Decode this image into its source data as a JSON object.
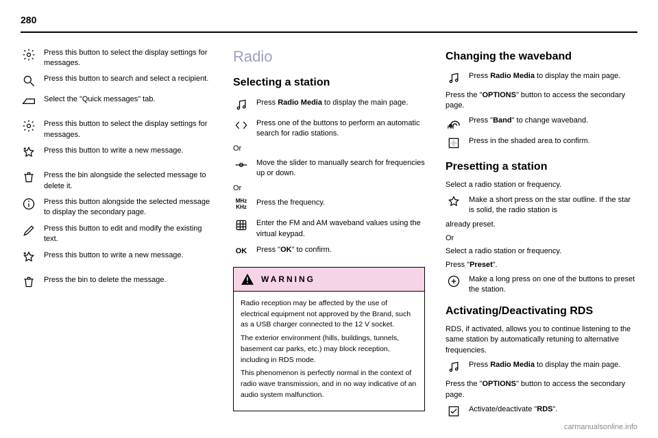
{
  "page_number": "280",
  "col1": {
    "items": [
      {
        "icon": "gear",
        "text": "Press this button to select the display settings for messages."
      },
      {
        "icon": "magnify",
        "text": "Press this button to search and select a recipient."
      },
      {
        "icon": "tab",
        "text": "Select the \"Quick messages\" tab."
      },
      {
        "icon": "gear",
        "text": "Press this button to select the display settings for messages.",
        "gap": true
      },
      {
        "icon": "star-plus",
        "text": "Press this button to write a new message."
      },
      {
        "icon": "trash",
        "text": "Press the bin alongside the selected message to delete it.",
        "gap": true
      },
      {
        "icon": "info",
        "text": "Press this button alongside the selected message to display the secondary page."
      },
      {
        "icon": "pencil",
        "text": "Press this button to edit and modify the existing text."
      },
      {
        "icon": "star-plus",
        "text": "Press this button to write a new message."
      },
      {
        "icon": "trash",
        "text": "Press the bin to delete the message.",
        "gap": true
      }
    ]
  },
  "col2": {
    "section_title": "Radio",
    "sub1": "Selecting a station",
    "items1": [
      {
        "icon": "music",
        "text_pre": "Press ",
        "text_bold": "Radio Media",
        "text_post": " to display the main page."
      },
      {
        "icon": "arrows",
        "text": "Press one of the buttons to perform an automatic search for radio stations."
      }
    ],
    "or1": "Or",
    "items2": [
      {
        "icon": "slider",
        "text": "Move the slider to manually search for frequencies up or down."
      }
    ],
    "or2": "Or",
    "items3": [
      {
        "icon": "mhz",
        "text": "Press the frequency."
      },
      {
        "icon": "keypad",
        "text": "Enter the FM and AM waveband values using the virtual keypad."
      },
      {
        "icon": "ok",
        "text_pre": "Press \"",
        "text_bold": "OK",
        "text_post": "\" to confirm."
      }
    ],
    "warning_title": "WARNING",
    "warning_body": "Radio reception may be affected by the use of electrical equipment not approved by the Brand, such as a USB charger connected to the 12 V socket.\nThe exterior environment (hills, buildings, tunnels, basement car parks, etc.) may block reception, including in RDS mode.\nThis phenomenon is perfectly normal in the context of radio wave transmission, and in no way indicative of an audio system malfunction."
  },
  "col3": {
    "sub1": "Changing the waveband",
    "items1": [
      {
        "icon": "music",
        "text_pre": "Press ",
        "text_bold": "Radio Media",
        "text_post": " to display the main page."
      }
    ],
    "para1_pre": "Press the \"",
    "para1_bold": "OPTIONS",
    "para1_post": "\" button to access the secondary page.",
    "items2": [
      {
        "icon": "fm",
        "text_pre": "Press \"",
        "text_bold": "Band",
        "text_post": "\" to change waveband."
      },
      {
        "icon": "grid",
        "text": "Press in the shaded area to confirm."
      }
    ],
    "sub2": "Presetting a station",
    "para2": "Select a radio station or frequency.",
    "items3": [
      {
        "icon": "star",
        "text": "Make a short press on the star outline. If the star is solid, the radio station is"
      }
    ],
    "para3": "already preset.",
    "or1": "Or",
    "para4": "Select a radio station or frequency.",
    "para5_pre": "Press \"",
    "para5_bold": "Preset",
    "para5_post": "\".",
    "items4": [
      {
        "icon": "plus-circle",
        "text": "Make a long press on one of the buttons to preset the station."
      }
    ],
    "sub3": "Activating/Deactivating RDS",
    "para6": "RDS, if activated, allows you to continue listening to the same station by automatically retuning to alternative frequencies.",
    "items5": [
      {
        "icon": "music",
        "text_pre": "Press ",
        "text_bold": "Radio Media",
        "text_post": " to display the main page."
      }
    ],
    "para7_pre": "Press the \"",
    "para7_bold": "OPTIONS",
    "para7_post": "\" button to access the secondary page.",
    "items6": [
      {
        "icon": "check",
        "text_pre": "Activate/deactivate \"",
        "text_bold": "RDS",
        "text_post": "\"."
      }
    ]
  },
  "footer": "carmanualsonline.info",
  "icon_labels": {
    "mhz_line1": "MHz",
    "mhz_line2": "KHz",
    "ok": "OK"
  }
}
